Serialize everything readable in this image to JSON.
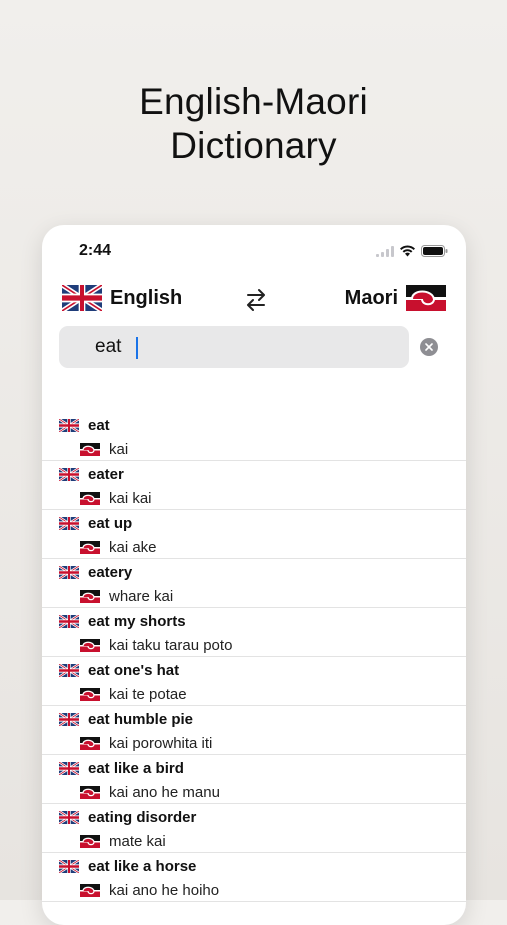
{
  "headline": {
    "line1": "English-Maori",
    "line2": "Dictionary"
  },
  "status": {
    "time": "2:44"
  },
  "languages": {
    "source": "English",
    "target": "Maori"
  },
  "search": {
    "value": "eat"
  },
  "colors": {
    "accent": "#1a73e8",
    "union_blue": "#1f3d7a",
    "union_red": "#c8102e",
    "tino_red": "#c8102e"
  },
  "icons": {
    "swap": "swap-arrows-icon",
    "clear": "clear-circle-icon",
    "english_flag": "uk-flag-icon",
    "maori_flag": "tino-rangatiratanga-flag-icon"
  },
  "results": [
    {
      "en": "eat",
      "mi": "kai"
    },
    {
      "en": "eater",
      "mi": "kai kai"
    },
    {
      "en": "eat up",
      "mi": "kai ake"
    },
    {
      "en": "eatery",
      "mi": "whare kai"
    },
    {
      "en": "eat my shorts",
      "mi": "kai taku tarau poto"
    },
    {
      "en": "eat one's hat",
      "mi": "kai te potae"
    },
    {
      "en": "eat humble pie",
      "mi": "kai porowhita iti"
    },
    {
      "en": "eat like a bird",
      "mi": "kai ano he manu"
    },
    {
      "en": "eating disorder",
      "mi": "mate kai"
    },
    {
      "en": "eat like a horse",
      "mi": "kai ano he hoiho"
    }
  ]
}
